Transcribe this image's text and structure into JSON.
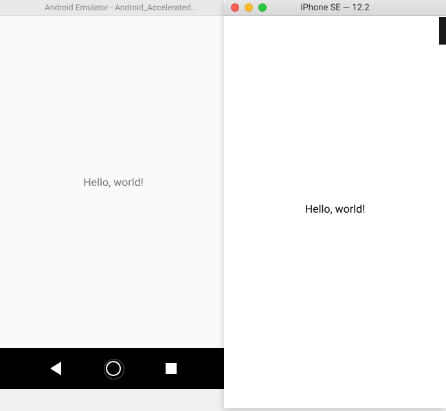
{
  "android": {
    "titlebar": "Android Emulator - Android_Accelerated...",
    "content": "Hello, world!"
  },
  "ios": {
    "titlebar": "iPhone SE — 12.2",
    "content": "Hello, world!"
  }
}
